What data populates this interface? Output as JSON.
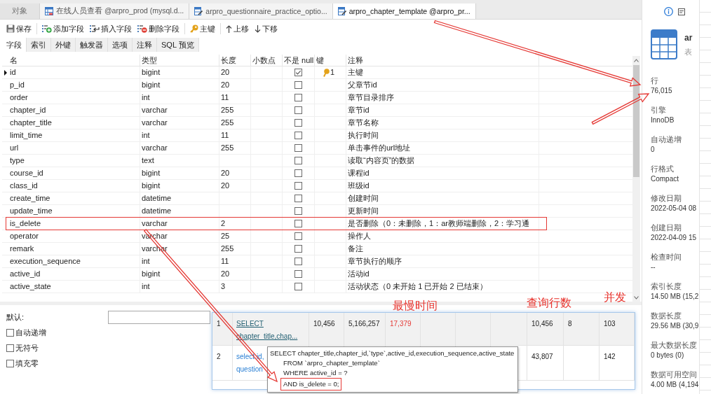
{
  "tabs": [
    {
      "label": "对象",
      "kind": "objects",
      "selected": false
    },
    {
      "label": "在线人员查看 @arpro_prod (mysql.d...",
      "kind": "view",
      "selected": false
    },
    {
      "label": "arpro_questionnaire_practice_optio...",
      "kind": "table",
      "selected": false
    },
    {
      "label": "arpro_chapter_template @arpro_pr...",
      "kind": "table",
      "selected": true
    }
  ],
  "toolbar": [
    [
      {
        "label": "保存",
        "kind": "save"
      }
    ],
    [
      {
        "label": "添加字段",
        "kind": "add"
      },
      {
        "label": "插入字段",
        "kind": "insert"
      },
      {
        "label": "删除字段",
        "kind": "delete"
      }
    ],
    [
      {
        "label": "主键",
        "kind": "key"
      }
    ],
    [
      {
        "label": "上移",
        "kind": "up"
      },
      {
        "label": "下移",
        "kind": "down"
      }
    ]
  ],
  "subtabs": [
    {
      "label": "字段",
      "selected": true
    },
    {
      "label": "索引",
      "selected": false
    },
    {
      "label": "外键",
      "selected": false
    },
    {
      "label": "触发器",
      "selected": false
    },
    {
      "label": "选项",
      "selected": false
    },
    {
      "label": "注释",
      "selected": false
    },
    {
      "label": "SQL 预览",
      "selected": false
    }
  ],
  "fields": {
    "columns": [
      "名",
      "类型",
      "长度",
      "小数点",
      "不是 null",
      "键",
      "注释"
    ],
    "rows": [
      {
        "name": "id",
        "type": "bigint",
        "length": "20",
        "not_null": true,
        "key": "1",
        "comment": "主键",
        "current": true,
        "annotated": false
      },
      {
        "name": "p_id",
        "type": "bigint",
        "length": "20",
        "not_null": false,
        "comment": "父章节id",
        "current": false,
        "annotated": false
      },
      {
        "name": "order",
        "type": "int",
        "length": "11",
        "not_null": false,
        "comment": "章节目录排序",
        "current": false,
        "annotated": false
      },
      {
        "name": "chapter_id",
        "type": "varchar",
        "length": "255",
        "not_null": false,
        "comment": "章节id",
        "current": false,
        "annotated": false
      },
      {
        "name": "chapter_title",
        "type": "varchar",
        "length": "255",
        "not_null": false,
        "comment": "章节名称",
        "current": false,
        "annotated": false
      },
      {
        "name": "limit_time",
        "type": "int",
        "length": "11",
        "not_null": false,
        "comment": "执行时间",
        "current": false,
        "annotated": false
      },
      {
        "name": "url",
        "type": "varchar",
        "length": "255",
        "not_null": false,
        "comment": "单击事件的url地址",
        "current": false,
        "annotated": false
      },
      {
        "name": "type",
        "type": "text",
        "not_null": false,
        "comment": "读取“内容页”的数据",
        "current": false,
        "annotated": false
      },
      {
        "name": "course_id",
        "type": "bigint",
        "length": "20",
        "not_null": false,
        "comment": "课程id",
        "current": false,
        "annotated": false
      },
      {
        "name": "class_id",
        "type": "bigint",
        "length": "20",
        "not_null": false,
        "comment": "班级id",
        "current": false,
        "annotated": false
      },
      {
        "name": "create_time",
        "type": "datetime",
        "not_null": false,
        "comment": "创建时间",
        "current": false,
        "annotated": false
      },
      {
        "name": "update_time",
        "type": "datetime",
        "not_null": false,
        "comment": "更新时间",
        "current": false,
        "annotated": false
      },
      {
        "name": "is_delete",
        "type": "varchar",
        "length": "2",
        "not_null": false,
        "comment": "是否删除（0：未删除，1：ar教师端删除，2：学习通",
        "current": false,
        "annotated": true
      },
      {
        "name": "operator",
        "type": "varchar",
        "length": "25",
        "not_null": false,
        "comment": "操作人",
        "current": false,
        "annotated": false
      },
      {
        "name": "remark",
        "type": "varchar",
        "length": "255",
        "not_null": false,
        "comment": "备注",
        "current": false,
        "annotated": false
      },
      {
        "name": "execution_sequence",
        "type": "int",
        "length": "11",
        "not_null": false,
        "comment": "章节执行的顺序",
        "current": false,
        "annotated": false
      },
      {
        "name": "active_id",
        "type": "bigint",
        "length": "20",
        "not_null": false,
        "comment": "活动id",
        "current": false,
        "annotated": false
      },
      {
        "name": "active_state",
        "type": "int",
        "length": "3",
        "not_null": false,
        "comment": "活动状态（0 未开始 1 已开始 2 已结束）",
        "current": false,
        "annotated": false
      }
    ]
  },
  "field_options": {
    "default_label": "默认:",
    "checkboxes": [
      {
        "label": "自动递增",
        "checked": false
      },
      {
        "label": "无符号",
        "checked": false
      },
      {
        "label": "填充零",
        "checked": false
      }
    ]
  },
  "table_info": {
    "name": "ar",
    "type": "表",
    "properties": [
      {
        "label": "行",
        "value": "76,015"
      },
      {
        "label": "引擎",
        "value": "InnoDB"
      },
      {
        "label": "自动递增",
        "value": "0"
      },
      {
        "label": "行格式",
        "value": "Compact"
      },
      {
        "label": "修改日期",
        "value": "2022-05-04 08"
      },
      {
        "label": "创建日期",
        "value": "2022-04-09 15"
      },
      {
        "label": "检查时间",
        "value": "--"
      },
      {
        "label": "索引长度",
        "value": "14.50 MB (15,2"
      },
      {
        "label": "数据长度",
        "value": "29.56 MB (30,9"
      },
      {
        "label": "最大数据长度",
        "value": "0 bytes (0)"
      },
      {
        "label": "数据可用空间",
        "value": "4.00 MB (4,194"
      }
    ]
  },
  "query_stats_inset": {
    "rows": [
      {
        "number": "1",
        "sql": "SELECT chapter_title,chap...",
        "hovered": true,
        "column_3": "10,456",
        "column_4": "5,166,257",
        "column_5": "17,379",
        "column_5_alert": true,
        "column_9": "10,456",
        "column_10": "8",
        "column_11": "103"
      },
      {
        "number": "2",
        "sql": "select id, question",
        "hovered": false,
        "column_9": "43,807",
        "column_11": "142"
      }
    ],
    "tooltip": {
      "lines": [
        {
          "text": "SELECT chapter_title,chapter_id,`type`,active_id,execution_sequence,active_state",
          "indented": false,
          "annotated": false
        },
        {
          "text": "FROM `arpro_chapter_template`",
          "indented": true,
          "annotated": false
        },
        {
          "text": "WHERE active_id = ?",
          "indented": true,
          "annotated": false
        },
        {
          "text": "AND is_delete = 0;",
          "indented": true,
          "annotated": true
        }
      ]
    }
  },
  "annotation_labels": [
    "最慢时间",
    "查询行数",
    "并发"
  ]
}
